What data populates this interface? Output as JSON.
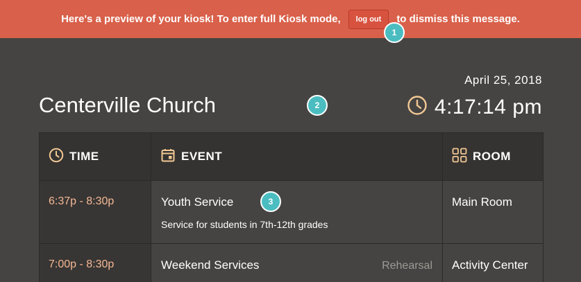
{
  "banner": {
    "text_before": "Here's a preview of your kiosk! To enter full Kiosk mode,",
    "logout_label": "log out",
    "text_after": "to dismiss this message."
  },
  "badges": [
    "1",
    "2",
    "3"
  ],
  "header": {
    "date": "April 25, 2018",
    "church_name": "Centerville Church",
    "clock_time": "4:17:14 pm"
  },
  "table": {
    "columns": [
      {
        "label": "TIME",
        "icon": "clock-icon"
      },
      {
        "label": "EVENT",
        "icon": "calendar-icon"
      },
      {
        "label": "ROOM",
        "icon": "grid-icon"
      }
    ],
    "rows": [
      {
        "time": "6:37p - 8:30p",
        "event": "Youth Service",
        "description": "Service for students in 7th-12th grades",
        "tag": "",
        "room": "Main Room"
      },
      {
        "time": "7:00p - 8:30p",
        "event": "Weekend Services",
        "description": "",
        "tag": "Rehearsal",
        "room": "Activity Center"
      }
    ]
  },
  "colors": {
    "banner": "#d9604a",
    "background": "#464442",
    "header_row": "#353331",
    "time_text": "#f5b896",
    "icon_accent": "#f2c894",
    "badge": "#4bbdc0"
  }
}
